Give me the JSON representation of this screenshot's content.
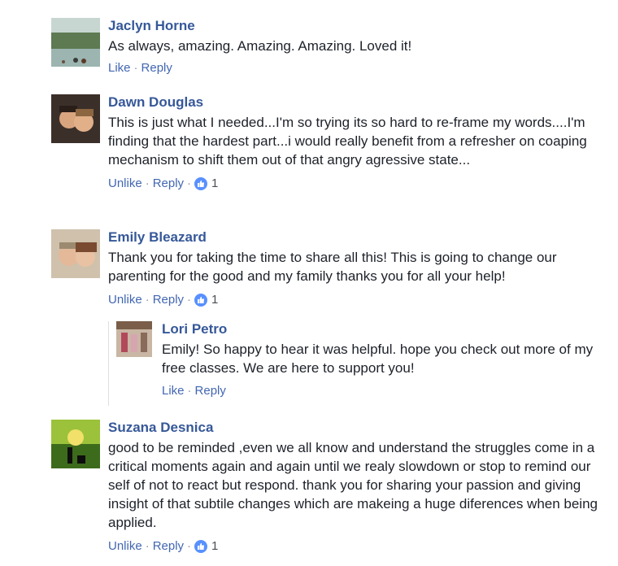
{
  "comments": [
    {
      "author": "Jaclyn Horne",
      "text": "As always, amazing. Amazing. Amazing. Loved it!",
      "actions": {
        "like": "Like",
        "reply": "Reply"
      },
      "avatar": "landscape-photo"
    },
    {
      "author": "Dawn Douglas",
      "text": "This is just what I needed...I'm so trying its so hard to re-frame my words....I'm finding that the hardest part...i would really benefit from a refresher on coaping mechanism to shift them out of that angry agressive state...",
      "actions": {
        "like": "Unlike",
        "reply": "Reply"
      },
      "likes": "1",
      "avatar": "couple-photo"
    },
    {
      "author": "Emily Bleazard",
      "text": "Thank you for taking the time to share all this! This is going to change our parenting for the good and my family thanks you for all your help!",
      "actions": {
        "like": "Unlike",
        "reply": "Reply"
      },
      "likes": "1",
      "avatar": "couple-photo"
    },
    {
      "author": "Suzana Desnica",
      "text": "good to be reminded ,even we all know and understand the struggles come in a critical moments again and again until we realy slowdown or stop to remind our self of not to react but respond. thank you for sharing your passion and giving insight of that subtile changes which are makeing a huge diferences when being applied.",
      "actions": {
        "like": "Unlike",
        "reply": "Reply"
      },
      "likes": "1",
      "avatar": "silhouette-photo"
    }
  ],
  "reply": {
    "author": "Lori Petro",
    "text": "Emily! So happy to hear it was helpful. hope you check out more of my free classes. We are here to support you!",
    "actions": {
      "like": "Like",
      "reply": "Reply"
    },
    "avatar": "group-photo"
  },
  "colors": {
    "link": "#365899",
    "action": "#4267b2",
    "like_badge": "#5890ff"
  }
}
